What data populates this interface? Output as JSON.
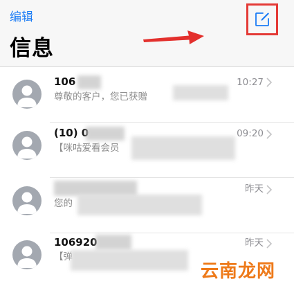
{
  "header": {
    "edit_label": "编辑",
    "title": "信息",
    "compose_icon": "compose-icon",
    "highlight_color": "#e43a36",
    "accent_color": "#1b7cf5"
  },
  "messages": [
    {
      "sender": "106",
      "preview": "尊敬的客户，您已获赠",
      "time": "10:27"
    },
    {
      "sender": "(10) 0",
      "preview": "【咪咕爱看会员",
      "time": "09:20"
    },
    {
      "sender": "",
      "preview": "您的",
      "time": "昨天"
    },
    {
      "sender": "106920",
      "preview": "【弹",
      "time": "昨天"
    }
  ],
  "watermark": {
    "text": "云南龙网",
    "color": "#ee7a1a"
  }
}
